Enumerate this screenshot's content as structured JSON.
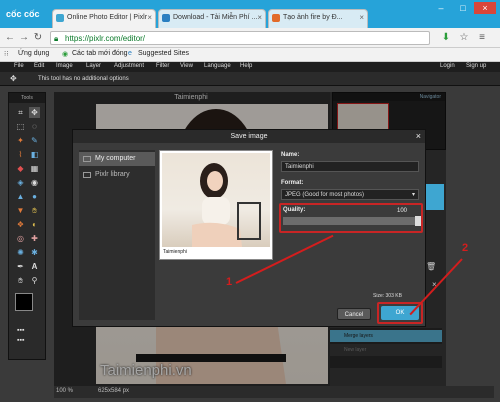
{
  "browser": {
    "logo": "cốc cốc",
    "tabs": [
      {
        "title": "Online Photo Editor | Pixlr"
      },
      {
        "title": "Download - Tải Miễn Phí ..."
      },
      {
        "title": "Tạo ảnh fire by Đ..."
      }
    ],
    "url": "https://pixlr.com/editor/",
    "bookmarks": [
      "Ứng dụng",
      "Các tab mới đóng",
      "Suggested Sites"
    ]
  },
  "menu": {
    "items": [
      "File",
      "Edit",
      "Image",
      "Layer",
      "Adjustment",
      "Filter",
      "View",
      "Language",
      "Help"
    ],
    "right": [
      "Login",
      "Sign up"
    ]
  },
  "options": {
    "message": "This tool has no additional options"
  },
  "tools": {
    "title": "Tools"
  },
  "canvas": {
    "title": "Taimienphi",
    "watermark": "Taimienphi.vn"
  },
  "navigator": {
    "title": "Navigator"
  },
  "layers": {
    "items": [
      "Merge layers",
      "New layer"
    ]
  },
  "status": {
    "zoom": "100 %",
    "dimensions": "625x584 px"
  },
  "dialog": {
    "title": "Save image",
    "sources": [
      "My computer",
      "Pixlr library"
    ],
    "preview_caption": "Taimienphi",
    "name_label": "Name:",
    "name_value": "Taimienphi",
    "format_label": "Format:",
    "format_value": "JPEG (Good for most photos)",
    "quality_label": "Quality:",
    "quality_value": "100",
    "size_text": "Size: 303 KB",
    "cancel_label": "Cancel",
    "ok_label": "OK"
  },
  "annotations": {
    "step1": "1",
    "step2": "2"
  },
  "colors": {
    "accent": "#3ea6d1",
    "annotation": "#d41d1d",
    "browser_bar": "#26a3d9"
  }
}
